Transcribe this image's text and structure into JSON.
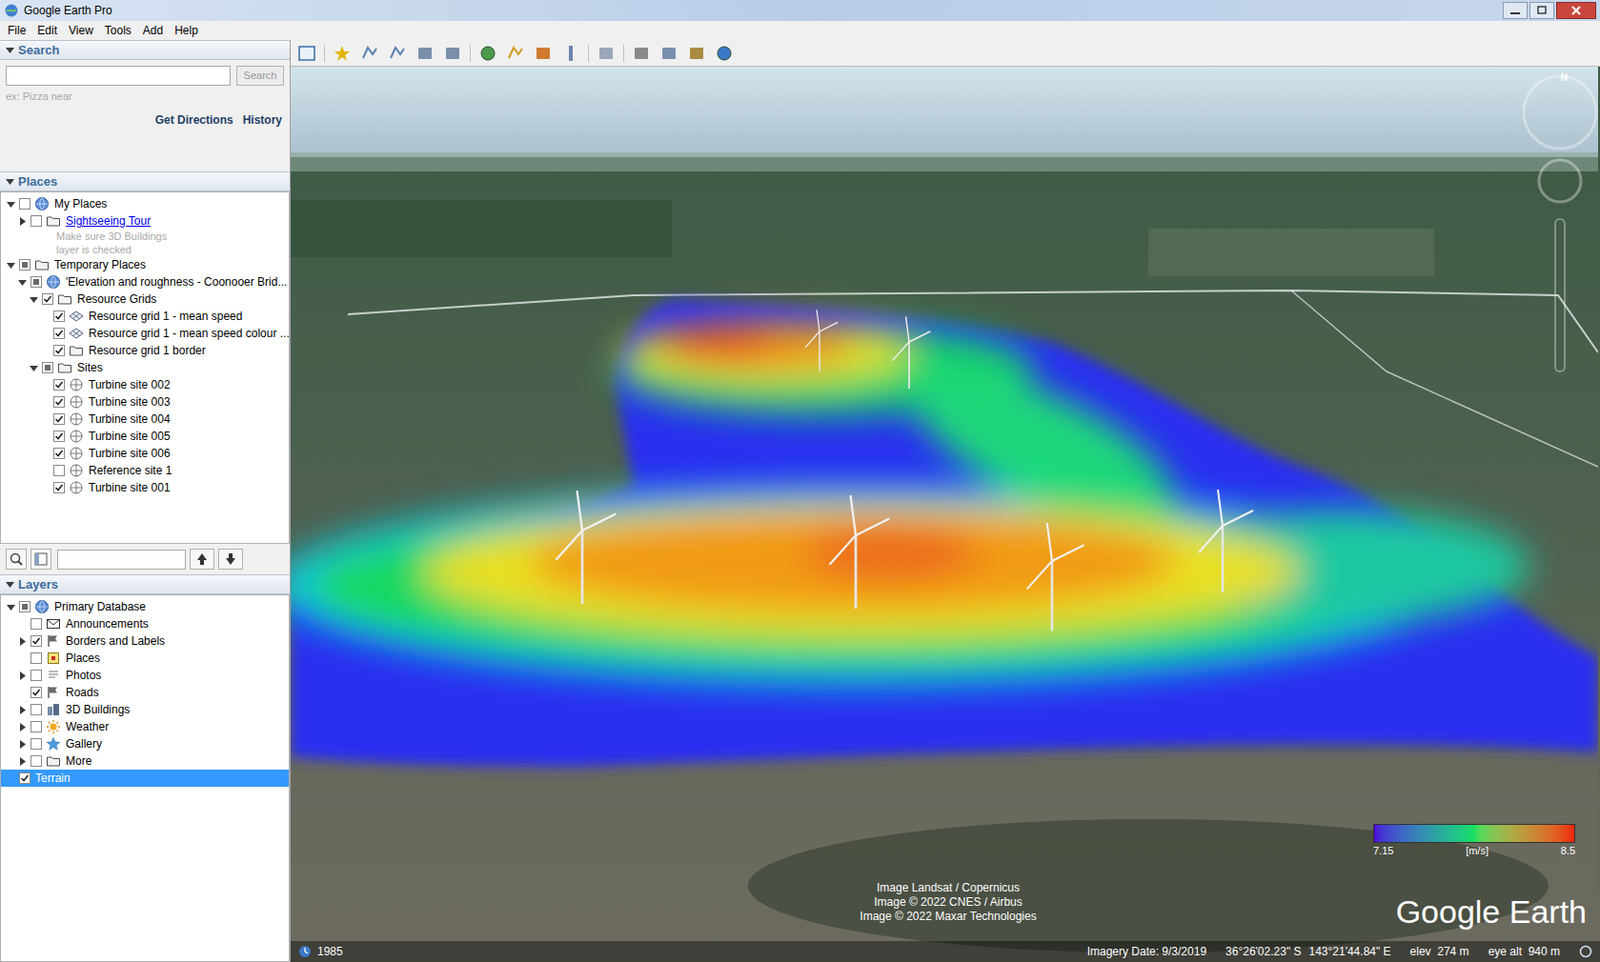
{
  "window": {
    "title": "Google Earth Pro"
  },
  "menu": [
    "File",
    "Edit",
    "View",
    "Tools",
    "Add",
    "Help"
  ],
  "search": {
    "header": "Search",
    "expanded": true,
    "field": "",
    "button": "Search",
    "hint": "ex: Pizza near",
    "links": [
      "Get Directions",
      "History"
    ]
  },
  "places": {
    "header": "Places",
    "expanded": true,
    "tree": [
      {
        "label": "My Places",
        "kind": "globe",
        "checked": false,
        "partial": false,
        "expanded": true,
        "selected": false,
        "children": [
          {
            "label": "Sightseeing Tour",
            "kind": "folder",
            "link": true,
            "checked": false,
            "partial": false,
            "expanded": false,
            "selected": false
          },
          {
            "label": "Make sure 3D Buildings",
            "kind": "note",
            "selected": false
          },
          {
            "label": "layer is checked",
            "kind": "note",
            "selected": false
          }
        ]
      },
      {
        "label": "Temporary Places",
        "kind": "folder",
        "checked": false,
        "partial": true,
        "expanded": true,
        "selected": false,
        "children": [
          {
            "label": "'Elevation and roughness - Coonooer Brid...",
            "kind": "globe",
            "checked": false,
            "partial": true,
            "expanded": true,
            "selected": false,
            "children": [
              {
                "label": "Resource Grids",
                "kind": "folder",
                "checked": true,
                "partial": false,
                "expanded": true,
                "selected": false,
                "children": [
                  {
                    "label": "Resource grid 1 - mean speed",
                    "kind": "grid",
                    "checked": true,
                    "partial": false,
                    "selected": false
                  },
                  {
                    "label": "Resource grid 1 - mean speed colour ...",
                    "kind": "grid",
                    "checked": true,
                    "partial": false,
                    "selected": false
                  },
                  {
                    "label": "Resource grid 1 border",
                    "kind": "folder",
                    "checked": true,
                    "partial": false,
                    "selected": false
                  }
                ]
              },
              {
                "label": "Sites",
                "kind": "folder",
                "checked": false,
                "partial": true,
                "expanded": true,
                "selected": false,
                "children": [
                  {
                    "label": "Turbine site 002",
                    "kind": "site",
                    "checked": true,
                    "partial": false,
                    "selected": false
                  },
                  {
                    "label": "Turbine site 003",
                    "kind": "site",
                    "checked": true,
                    "partial": false,
                    "selected": false
                  },
                  {
                    "label": "Turbine site 004",
                    "kind": "site",
                    "checked": true,
                    "partial": false,
                    "selected": false
                  },
                  {
                    "label": "Turbine site 005",
                    "kind": "site",
                    "checked": true,
                    "partial": false,
                    "selected": false
                  },
                  {
                    "label": "Turbine site 006",
                    "kind": "site",
                    "checked": true,
                    "partial": false,
                    "selected": false
                  },
                  {
                    "label": "Reference site 1",
                    "kind": "site",
                    "checked": false,
                    "partial": false,
                    "selected": false
                  },
                  {
                    "label": "Turbine site 001",
                    "kind": "site",
                    "checked": true,
                    "partial": false,
                    "selected": false
                  }
                ]
              }
            ]
          }
        ]
      }
    ]
  },
  "places_toolbar": {
    "field": ""
  },
  "layers": {
    "header": "Layers",
    "expanded": true,
    "tree": [
      {
        "label": "Primary Database",
        "kind": "globe",
        "checked": false,
        "partial": true,
        "expanded": true,
        "selected": false,
        "children": [
          {
            "label": "Announcements",
            "kind": "envelope",
            "checked": false,
            "partial": false,
            "selected": false
          },
          {
            "label": "Borders and Labels",
            "kind": "flag",
            "checked": true,
            "partial": false,
            "expanded": false,
            "selected": false
          },
          {
            "label": "Places",
            "kind": "square",
            "checked": false,
            "partial": false,
            "selected": false
          },
          {
            "label": "Photos",
            "kind": "photo",
            "checked": false,
            "partial": false,
            "expanded": false,
            "selected": false
          },
          {
            "label": "Roads",
            "kind": "flag",
            "checked": true,
            "partial": false,
            "selected": false
          },
          {
            "label": "3D Buildings",
            "kind": "building",
            "checked": false,
            "partial": false,
            "expanded": false,
            "selected": false
          },
          {
            "label": "Weather",
            "kind": "sun",
            "checked": false,
            "partial": false,
            "expanded": false,
            "selected": false
          },
          {
            "label": "Gallery",
            "kind": "star",
            "checked": false,
            "partial": false,
            "expanded": false,
            "selected": false
          },
          {
            "label": "More",
            "kind": "folder",
            "checked": false,
            "partial": false,
            "expanded": false,
            "selected": false
          }
        ]
      },
      {
        "label": "Terrain",
        "kind": "plain",
        "checked": true,
        "partial": false,
        "selected": true
      }
    ]
  },
  "map": {
    "compass": "N",
    "legend": {
      "min": "7.15",
      "unit": "[m/s]",
      "max": "8.5"
    },
    "attribution": [
      "Image Landsat / Copernicus",
      "Image © 2022 CNES / Airbus",
      "Image © 2022 Maxar Technologies"
    ],
    "logo": "Google Earth"
  },
  "status_bar": {
    "year": "1985",
    "imagery_date": "Imagery Date: 9/3/2019",
    "lat": "36°26'02.23\" S",
    "lon": "143°21'44.84\" E",
    "elev": "elev  274 m",
    "eye_alt": "eye alt  940 m"
  }
}
